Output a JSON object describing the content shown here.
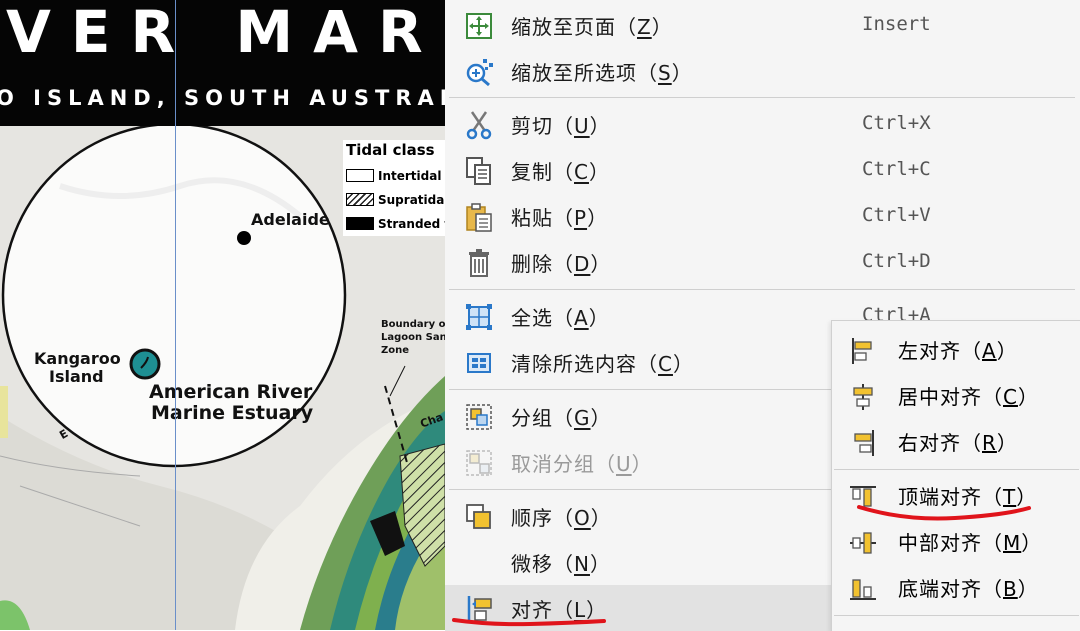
{
  "map": {
    "title": "VER MARIN",
    "subtitle": "O ISLAND, SOUTH AUSTRAL",
    "legend": {
      "title": "Tidal class",
      "items": [
        "Intertidal",
        "Supratidal",
        "Stranded t"
      ]
    },
    "labels": {
      "adelaide": "Adelaide",
      "kangaroo_line1": "Kangaroo",
      "kangaroo_line2": "Island",
      "estuary_line1": "American River",
      "estuary_line2": "Marine Estuary",
      "boundary_line1": "Boundary of",
      "boundary_line2": "Lagoon Sanc",
      "boundary_line3": "Zone",
      "channel": "Cha",
      "edge": "E"
    }
  },
  "context_menu": {
    "items": [
      {
        "label": "缩放至页面",
        "key": "Z",
        "shortcut": "Insert",
        "icon": "zoom-to-page-icon"
      },
      {
        "label": "缩放至所选项",
        "key": "S",
        "shortcut": "",
        "icon": "zoom-to-selection-icon"
      },
      {
        "label": "剪切",
        "key": "U",
        "shortcut": "Ctrl+X",
        "icon": "scissors-icon"
      },
      {
        "label": "复制",
        "key": "C",
        "shortcut": "Ctrl+C",
        "icon": "copy-icon"
      },
      {
        "label": "粘贴",
        "key": "P",
        "shortcut": "Ctrl+V",
        "icon": "paste-icon"
      },
      {
        "label": "删除",
        "key": "D",
        "shortcut": "Ctrl+D",
        "icon": "trash-icon"
      },
      {
        "label": "全选",
        "key": "A",
        "shortcut": "Ctrl+A",
        "icon": "select-all-icon"
      },
      {
        "label": "清除所选内容",
        "key": "C",
        "shortcut": "",
        "icon": "clear-selection-icon"
      },
      {
        "label": "分组",
        "key": "G",
        "shortcut": "",
        "icon": "group-icon"
      },
      {
        "label": "取消分组",
        "key": "U",
        "shortcut": "",
        "icon": "ungroup-icon",
        "disabled": true
      },
      {
        "label": "顺序",
        "key": "O",
        "shortcut": "",
        "icon": "order-icon"
      },
      {
        "label": "微移",
        "key": "N",
        "shortcut": "",
        "icon": ""
      },
      {
        "label": "对齐",
        "key": "L",
        "shortcut": "",
        "icon": "align-icon",
        "highlighted": true
      }
    ]
  },
  "align_submenu": {
    "items": [
      {
        "label": "左对齐",
        "key": "A",
        "icon": "align-left-icon"
      },
      {
        "label": "居中对齐",
        "key": "C",
        "icon": "align-center-icon"
      },
      {
        "label": "右对齐",
        "key": "R",
        "icon": "align-right-icon"
      },
      {
        "label": "顶端对齐",
        "key": "T",
        "icon": "align-top-icon"
      },
      {
        "label": "中部对齐",
        "key": "M",
        "icon": "align-middle-icon"
      },
      {
        "label": "底端对齐",
        "key": "B",
        "icon": "align-bottom-icon"
      }
    ]
  },
  "annotation_color": "#e0141b",
  "accent_color": "#f2c230",
  "icon_blue": "#2a78c9"
}
